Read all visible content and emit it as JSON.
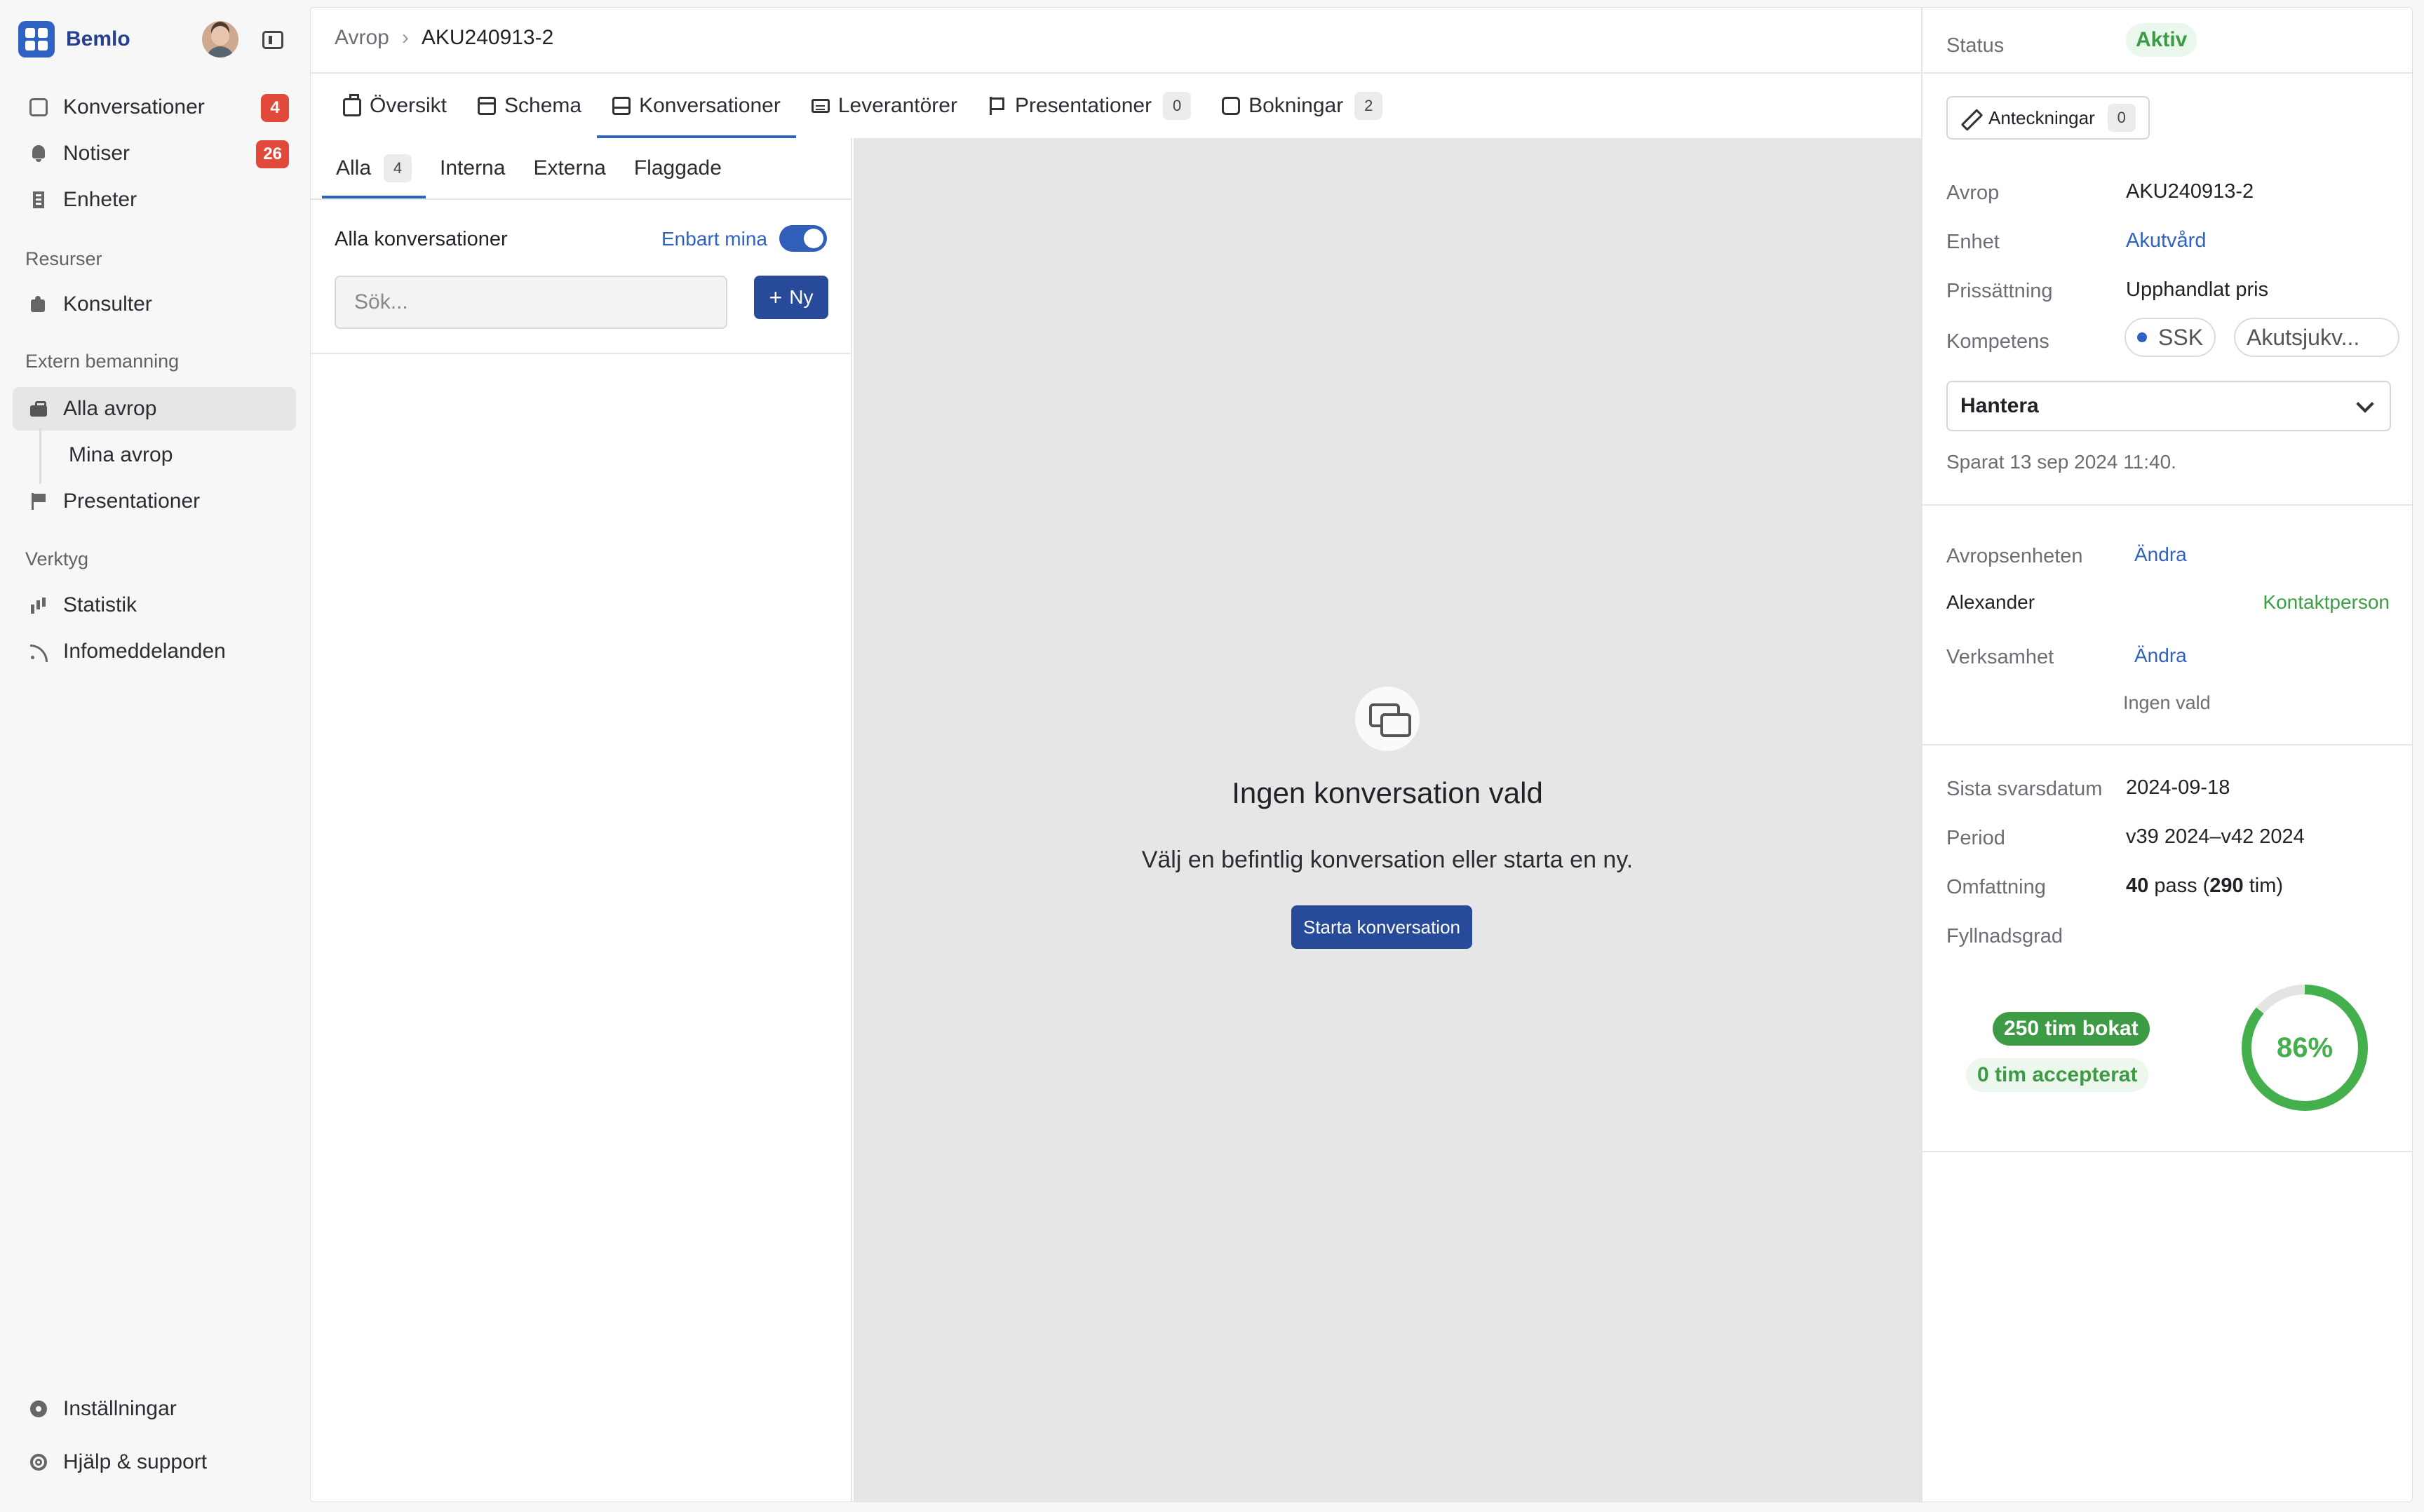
{
  "app": {
    "name": "Bemlo"
  },
  "sidebar": {
    "items": [
      {
        "label": "Konversationer",
        "badge": "4"
      },
      {
        "label": "Notiser",
        "badge": "26"
      },
      {
        "label": "Enheter"
      }
    ],
    "sections": [
      {
        "title": "Resurser",
        "items": [
          {
            "label": "Konsulter"
          }
        ]
      },
      {
        "title": "Extern bemanning",
        "items": [
          {
            "label": "Alla avrop"
          },
          {
            "label": "Mina avrop"
          },
          {
            "label": "Presentationer"
          }
        ]
      },
      {
        "title": "Verktyg",
        "items": [
          {
            "label": "Statistik"
          },
          {
            "label": "Infomeddelanden"
          }
        ]
      }
    ],
    "bottom": [
      {
        "label": "Inställningar"
      },
      {
        "label": "Hjälp & support"
      }
    ]
  },
  "breadcrumb": {
    "root": "Avrop",
    "current": "AKU240913-2"
  },
  "tabs": [
    {
      "label": "Översikt",
      "icon": "briefcase-icon"
    },
    {
      "label": "Schema",
      "icon": "calendar-icon"
    },
    {
      "label": "Konversationer",
      "icon": "inbox-icon",
      "active": true
    },
    {
      "label": "Leverantörer",
      "icon": "card-icon"
    },
    {
      "label": "Presentationer",
      "icon": "flag-icon",
      "count": "0"
    },
    {
      "label": "Bokningar",
      "icon": "puzzle-icon",
      "count": "2"
    }
  ],
  "conversations": {
    "subtabs": [
      {
        "label": "Alla",
        "count": "4",
        "active": true
      },
      {
        "label": "Interna"
      },
      {
        "label": "Externa"
      },
      {
        "label": "Flaggade"
      }
    ],
    "list_title": "Alla konversationer",
    "only_mine_label": "Enbart mina",
    "only_mine_on": true,
    "search_placeholder": "Sök...",
    "new_label": "Ny"
  },
  "empty_state": {
    "title": "Ingen konversation vald",
    "subtitle": "Välj en befintlig konversation eller starta en ny.",
    "button": "Starta konversation"
  },
  "details": {
    "status_label": "Status",
    "status_value": "Aktiv",
    "notes_label": "Anteckningar",
    "notes_count": "0",
    "avrop_label": "Avrop",
    "avrop_value": "AKU240913-2",
    "enhet_label": "Enhet",
    "enhet_value": "Akutvård",
    "pris_label": "Prissättning",
    "pris_value": "Upphandlat pris",
    "kompetens_label": "Kompetens",
    "kompetens_chips": [
      "SSK",
      "Akutsjukv..."
    ],
    "select_value": "Hantera",
    "saved_text": "Sparat 13 sep 2024 11:40.",
    "avropsenheten_label": "Avropsenheten",
    "change_label": "Ändra",
    "person_name": "Alexander",
    "contact_label": "Kontaktperson",
    "verksamhet_label": "Verksamhet",
    "verksamhet_value": "Ingen vald",
    "svarsdatum_label": "Sista svarsdatum",
    "svarsdatum_value": "2024-09-18",
    "period_label": "Period",
    "period_value": "v39 2024–v42 2024",
    "omfattning_label": "Omfattning",
    "omfattning_pass": "40",
    "omfattning_pass_unit": " pass (",
    "omfattning_hours": "290",
    "omfattning_hours_unit": " tim)",
    "fyllnadsgrad_label": "Fyllnadsgrad",
    "booked_text": "250 tim bokat",
    "accepted_text": "0 tim accepterat",
    "fill_percent_text": "86%",
    "fill_fraction": 0.86,
    "colors": {
      "accent": "#2f62c3",
      "green": "#3d9a45",
      "badge_red": "#e14a3b"
    }
  }
}
